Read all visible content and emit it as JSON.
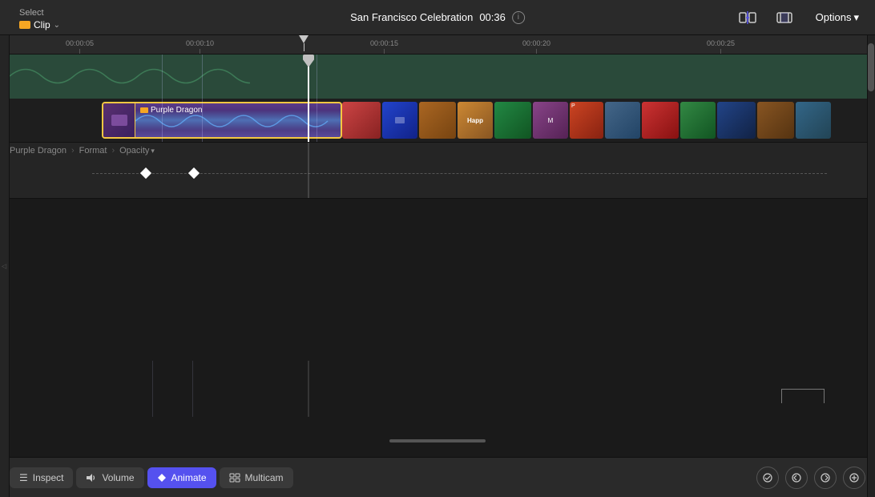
{
  "toolbar": {
    "select_label": "Select",
    "clip_label": "Clip",
    "title": "San Francisco Celebration",
    "time": "00:36",
    "options_label": "Options"
  },
  "ruler": {
    "marks": [
      {
        "label": "00:00:05",
        "position": 70
      },
      {
        "label": "00:00:10",
        "position": 220
      },
      {
        "label": "00:00:15",
        "position": 460
      },
      {
        "label": "00:00:20",
        "position": 650
      },
      {
        "label": "00:00:25",
        "position": 880
      }
    ]
  },
  "clips": {
    "purple_dragon": {
      "label": "Purple Dragon",
      "icon": "clip-icon"
    }
  },
  "keyframe": {
    "track_label": "Purple Dragon",
    "format_label": "Format",
    "opacity_label": "Opacity"
  },
  "bottom_toolbar": {
    "inspect_label": "Inspect",
    "volume_label": "Volume",
    "animate_label": "Animate",
    "multicam_label": "Multicam"
  },
  "icons": {
    "info": "i",
    "inspect": "☰",
    "volume": "🔊",
    "animate": "◆",
    "multicam": "⊞",
    "check": "✓",
    "prev_keyframe": "◇",
    "next_keyframe": "◇",
    "add_keyframe": "⊕",
    "snapping": "⊞",
    "trim": "⊡"
  },
  "colors": {
    "accent": "#5551ef",
    "gold": "#f5c842",
    "clip_bg": "#4a3a7a",
    "audio_bg": "#2a4a3a"
  }
}
